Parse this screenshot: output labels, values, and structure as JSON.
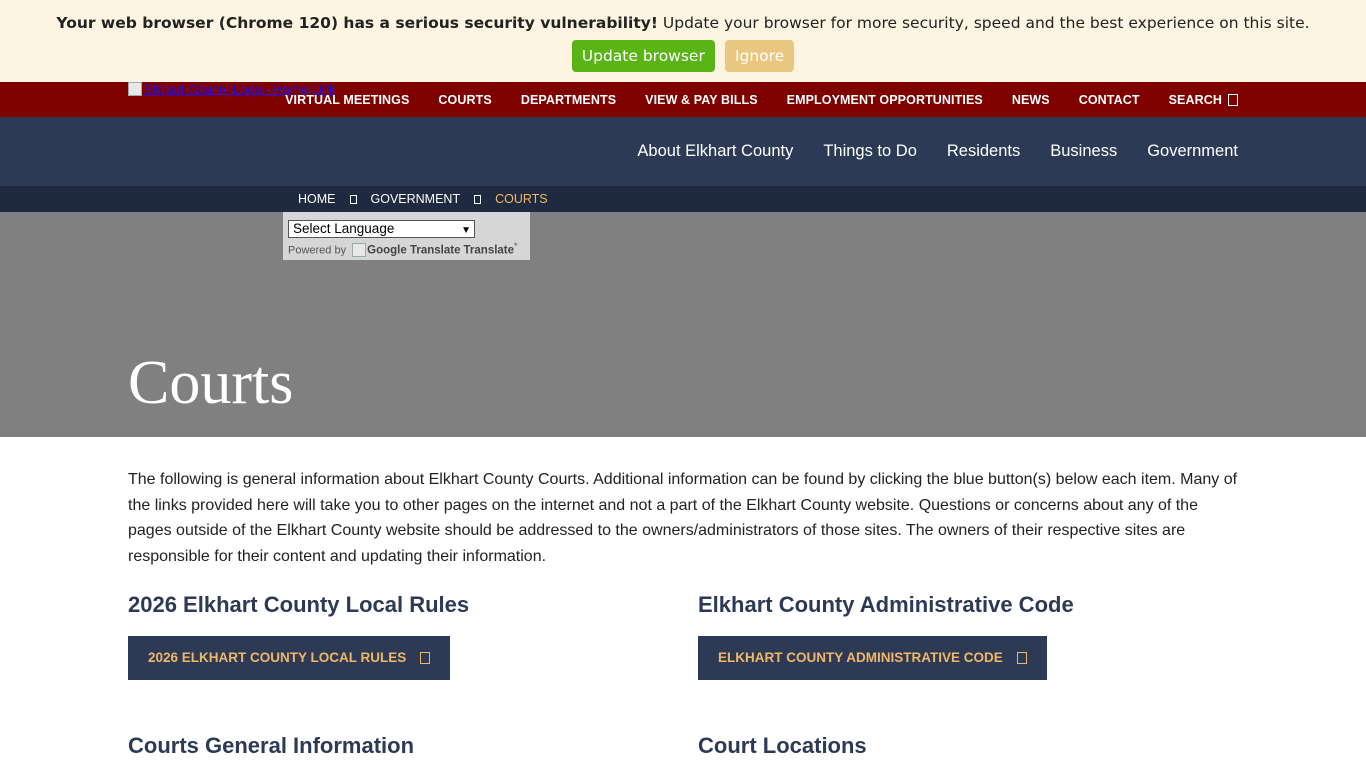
{
  "banner": {
    "bold": "Your web browser (Chrome 120) has a serious security vulnerability!",
    "text": " Update your browser for more security, speed and the best experience on this site.",
    "update_label": "Update browser",
    "ignore_label": "Ignore",
    "colors": {
      "background": "#fdf5e2",
      "update": "#5ab416",
      "ignore": "#eac77f"
    }
  },
  "utility_nav": {
    "logo_alt": "Elkhart County Logo - Home Link",
    "items": [
      "VIRTUAL MEETINGS",
      "COURTS",
      "DEPARTMENTS",
      "VIEW & PAY BILLS",
      "EMPLOYMENT OPPORTUNITIES",
      "NEWS",
      "CONTACT"
    ],
    "search_label": "SEARCH",
    "search_icon": "search-icon",
    "color": "#7e0100"
  },
  "main_nav": {
    "items": [
      "About Elkhart County",
      "Things to Do",
      "Residents",
      "Business",
      "Government"
    ],
    "color": "#2c3a56"
  },
  "breadcrumb": {
    "items": [
      "HOME",
      "GOVERNMENT"
    ],
    "current": "COURTS",
    "separator_icon": "chevron-right-icon"
  },
  "translate": {
    "select_value": "Select Language",
    "powered_by": "Powered by ",
    "google_alt": "Google Translate",
    "translate_label": "Translate"
  },
  "hero": {
    "title": "Courts"
  },
  "intro": "The following is general information about Elkhart County Courts. Additional information can be found by clicking the blue button(s) below each item. Many of the links provided here will take you to other pages on the internet and not a part of the Elkhart County website. Questions or concerns about any of the pages outside of the Elkhart County website should be addressed to the owners/administrators of those sites. The owners of their respective sites are responsible for their content and updating their information.",
  "sections": [
    {
      "title": "2026 Elkhart County Local Rules",
      "button": "2026 ELKHART COUNTY LOCAL RULES"
    },
    {
      "title": "Elkhart County Administrative Code",
      "button": "ELKHART COUNTY ADMINISTRATIVE CODE"
    },
    {
      "title": "Courts General Information"
    },
    {
      "title": "Court Locations"
    }
  ],
  "accent_color": "#f1b766"
}
